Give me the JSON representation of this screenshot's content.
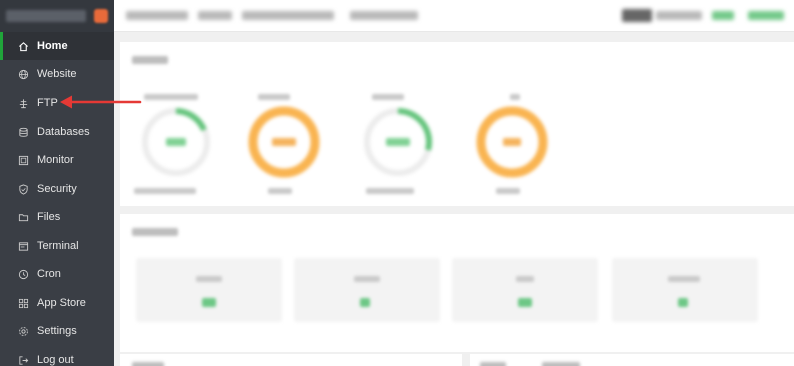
{
  "sidebar": {
    "items": [
      {
        "label": "Home",
        "icon": "home-icon",
        "active": true
      },
      {
        "label": "Website",
        "icon": "globe-icon"
      },
      {
        "label": "FTP",
        "icon": "ftp-icon"
      },
      {
        "label": "Databases",
        "icon": "database-icon"
      },
      {
        "label": "Monitor",
        "icon": "monitor-icon"
      },
      {
        "label": "Security",
        "icon": "shield-icon"
      },
      {
        "label": "Files",
        "icon": "folder-icon"
      },
      {
        "label": "Terminal",
        "icon": "terminal-icon"
      },
      {
        "label": "Cron",
        "icon": "clock-icon"
      },
      {
        "label": "App Store",
        "icon": "grid-icon"
      },
      {
        "label": "Settings",
        "icon": "gear-icon"
      },
      {
        "label": "Log out",
        "icon": "logout-icon"
      }
    ]
  },
  "colors": {
    "sidebar_bg": "#3a3e45",
    "accent_green": "#20a53a",
    "gauge_orange": "#f9b451",
    "arrow_red": "#e53935"
  }
}
